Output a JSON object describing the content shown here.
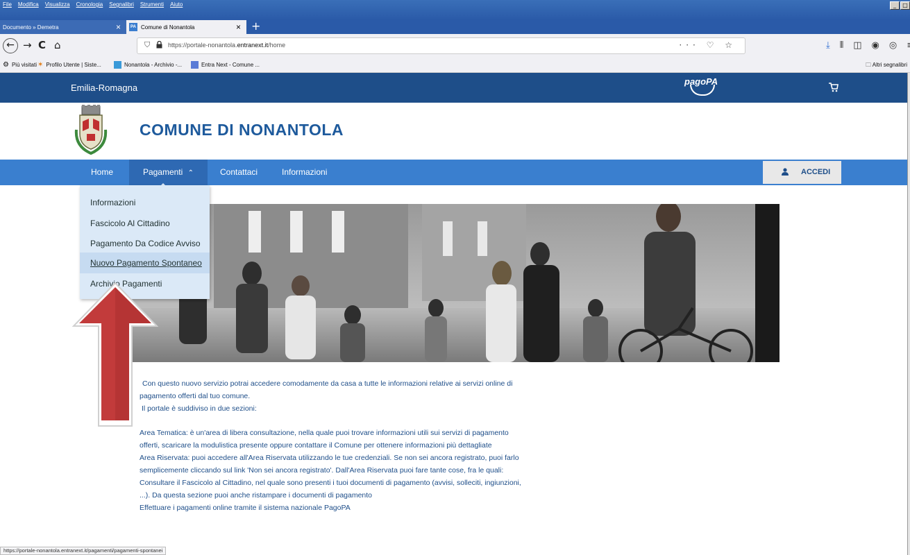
{
  "browser": {
    "menus": [
      "File",
      "Modifica",
      "Visualizza",
      "Cronologia",
      "Segnalibri",
      "Strumenti",
      "Aiuto"
    ],
    "tabs": [
      {
        "title": "Documento » Demetra"
      },
      {
        "title": "Comune di Nonantola",
        "favicon": "PA"
      }
    ],
    "url_prefix": "https://portale-nonantola.",
    "url_domain": "entranext.it",
    "url_path": "/home",
    "url_actions": "··· ♡ ☆",
    "bookmarks": [
      "Più visitati",
      "Profilo Utente | Siste...",
      "Nonantola - Archivio -...",
      "Entra Next - Comune ..."
    ],
    "other_bookmarks": "Altri segnalibri",
    "status_url": "https://portale-nonantola.entranext.it/pagamenti/pagamenti-spontanei"
  },
  "site": {
    "region": "Emilia-Romagna",
    "pagopa": "pagoPA",
    "comune": "COMUNE DI NONANTOLA",
    "accedi": "ACCEDI"
  },
  "nav": {
    "home": "Home",
    "pagamenti": "Pagamenti",
    "contattaci": "Contattaci",
    "informazioni": "Informazioni"
  },
  "dropdown": {
    "items": [
      "Informazioni",
      "Fascicolo Al Cittadino",
      "Pagamento Da Codice Avviso",
      "Nuovo Pagamento Spontaneo",
      "Archivio Pagamenti"
    ],
    "active_index": 3
  },
  "intro": {
    "p1": "Con questo nuovo servizio potrai accedere comodamente da casa a tutte le informazioni relative ai servizi online di pagamento offerti dal tuo comune.",
    "p2": "Il portale è suddiviso in due sezioni:",
    "p3": "Area Tematica: è un'area di libera consultazione, nella quale puoi trovare informazioni utili sui servizi di pagamento offerti, scaricare la modulistica presente oppure contattare il Comune per ottenere informazioni più dettagliate",
    "p4": "Area Riservata: puoi accedere all'Area Riservata utilizzando le tue credenziali. Se non sei ancora registrato, puoi farlo semplicemente cliccando sul link 'Non sei ancora registrato'. Dall'Area Riservata puoi fare tante cose, fra le quali:",
    "p5": "Consultare il Fascicolo al Cittadino, nel quale sono presenti i tuoi documenti di pagamento (avvisi, solleciti, ingiunzioni, ...). Da questa sezione puoi anche ristampare i documenti di pagamento",
    "p6": "Effettuare i pagamenti online tramite il sistema nazionale PagoPA"
  },
  "colors": {
    "topbar": "#1e4e89",
    "nav": "#3a7fcf",
    "dropdown": "#dbe9f7",
    "arrow": "#c23b3b"
  }
}
